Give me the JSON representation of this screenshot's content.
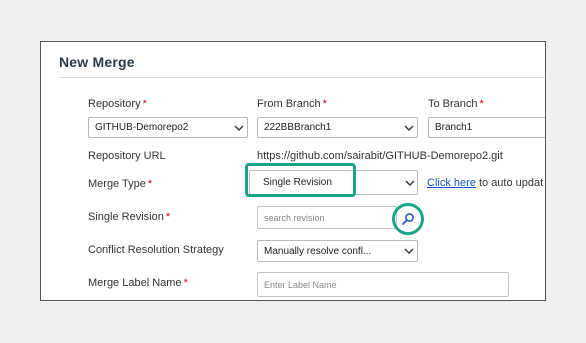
{
  "dialog": {
    "title": "New Merge"
  },
  "form": {
    "repository": {
      "label": "Repository",
      "required": "*",
      "value": "GITHUB-Demorepo2"
    },
    "from_branch": {
      "label": "From Branch",
      "required": "*",
      "value": "222BBBranch1"
    },
    "to_branch": {
      "label": "To Branch",
      "required": "*",
      "value": "Branch1"
    },
    "repository_url": {
      "label": "Repository URL",
      "value": "https://github.com/sairabit/GITHUB-Demorepo2.git"
    },
    "merge_type": {
      "label": "Merge Type",
      "required": "*",
      "value": "Single Revision",
      "hint_link": "Click here",
      "hint_text": " to auto updat"
    },
    "single_revision": {
      "label": "Single Revision",
      "required": "*",
      "placeholder": "search revision"
    },
    "conflict_strategy": {
      "label": "Conflict Resolution Strategy",
      "value": "Manually resolve confl..."
    },
    "merge_label": {
      "label": "Merge Label Name",
      "required": "*",
      "placeholder": "Enter Label Name"
    }
  },
  "colors": {
    "highlight": "#1aa58a",
    "link": "#1a56c4",
    "required": "#d0021b",
    "icon": "#2a55c8"
  },
  "icons": {
    "select_arrow": "chevron-down-icon",
    "search": "search-icon"
  }
}
